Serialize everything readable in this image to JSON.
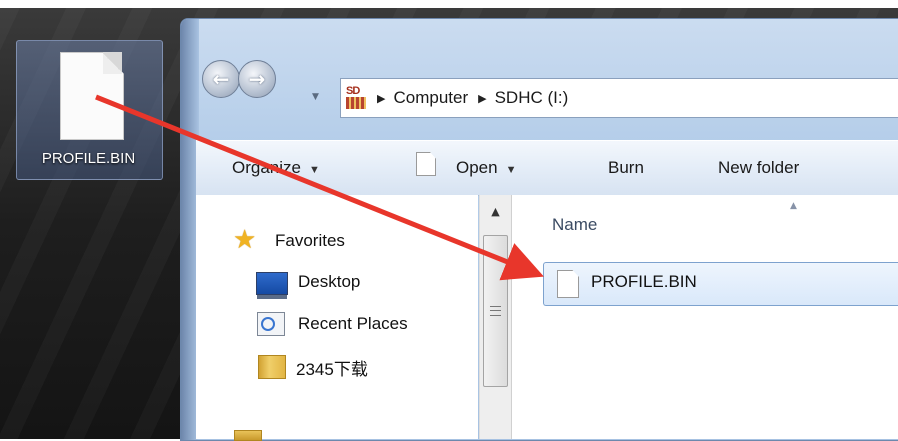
{
  "desktop": {
    "icon_label": "PROFILE.BIN"
  },
  "window": {
    "address": {
      "crumbs": [
        "Computer",
        "SDHC (I:)"
      ],
      "logo_text": "SD"
    },
    "toolbar": {
      "organize_label": "Organize",
      "open_label": "Open",
      "burn_label": "Burn",
      "new_folder_label": "New folder"
    },
    "nav_pane": {
      "items": [
        {
          "label": "Favorites",
          "icon": "star-icon"
        },
        {
          "label": "Desktop",
          "icon": "desktop-icon"
        },
        {
          "label": "Recent Places",
          "icon": "recent-places-icon"
        },
        {
          "label": "2345下载",
          "icon": "folder-icon"
        }
      ]
    },
    "content": {
      "column_header": "Name",
      "files": [
        {
          "name": "PROFILE.BIN",
          "icon": "file-icon",
          "selected": true
        }
      ]
    }
  },
  "annotation": {
    "arrow_color": "#e8362b"
  }
}
